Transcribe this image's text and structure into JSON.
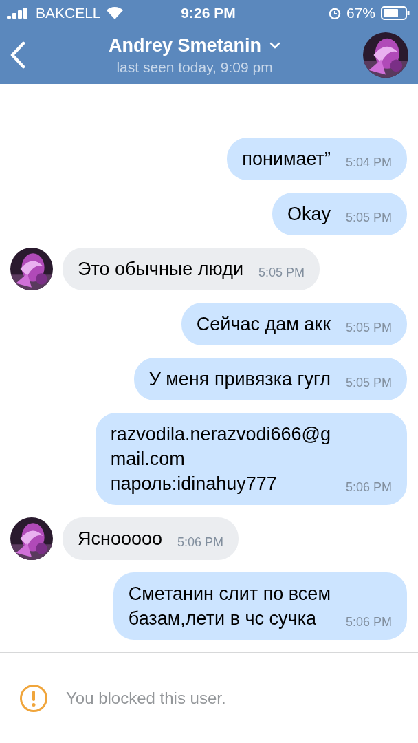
{
  "status_bar": {
    "carrier": "BAKCELL",
    "time": "9:26 PM",
    "battery": "67%"
  },
  "header": {
    "name": "Andrey Smetanin",
    "status": "last seen today, 9:09 pm"
  },
  "messages": [
    {
      "kind": "out",
      "lines": [
        "понимает”"
      ],
      "time": "5:04 PM"
    },
    {
      "kind": "out",
      "lines": [
        "Okay"
      ],
      "time": "5:05 PM"
    },
    {
      "kind": "in",
      "lines": [
        "Это обычные люди"
      ],
      "time": "5:05 PM"
    },
    {
      "kind": "out",
      "lines": [
        "Сейчас дам акк"
      ],
      "time": "5:05 PM"
    },
    {
      "kind": "out",
      "lines": [
        "У меня привязка гугл"
      ],
      "time": "5:05 PM"
    },
    {
      "kind": "out",
      "lines": [
        "razvodila.nerazvodi666@g",
        "mail.com",
        "пароль:idinahuy777"
      ],
      "time": "5:06 PM"
    },
    {
      "kind": "in",
      "lines": [
        "Ясноoooo"
      ],
      "time": "5:06 PM"
    },
    {
      "kind": "out",
      "lines": [
        "Сметанин слит по всем",
        "базам,лети в чс сучка"
      ],
      "time": "5:06 PM"
    }
  ],
  "notice": {
    "text": "You blocked this user."
  }
}
